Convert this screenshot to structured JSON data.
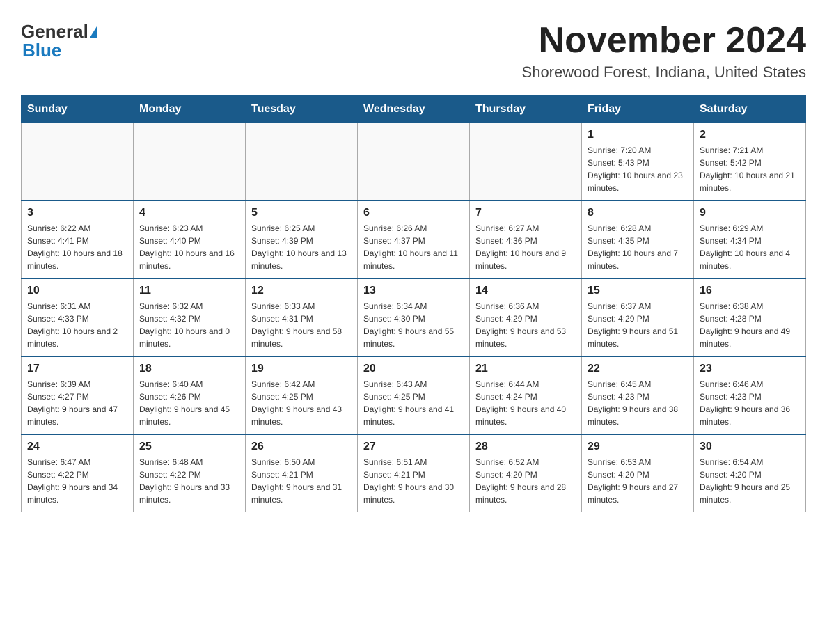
{
  "header": {
    "logo_general": "General",
    "logo_blue": "Blue",
    "month_year": "November 2024",
    "location": "Shorewood Forest, Indiana, United States"
  },
  "days_of_week": [
    "Sunday",
    "Monday",
    "Tuesday",
    "Wednesday",
    "Thursday",
    "Friday",
    "Saturday"
  ],
  "weeks": [
    [
      {
        "day": "",
        "sunrise": "",
        "sunset": "",
        "daylight": ""
      },
      {
        "day": "",
        "sunrise": "",
        "sunset": "",
        "daylight": ""
      },
      {
        "day": "",
        "sunrise": "",
        "sunset": "",
        "daylight": ""
      },
      {
        "day": "",
        "sunrise": "",
        "sunset": "",
        "daylight": ""
      },
      {
        "day": "",
        "sunrise": "",
        "sunset": "",
        "daylight": ""
      },
      {
        "day": "1",
        "sunrise": "Sunrise: 7:20 AM",
        "sunset": "Sunset: 5:43 PM",
        "daylight": "Daylight: 10 hours and 23 minutes."
      },
      {
        "day": "2",
        "sunrise": "Sunrise: 7:21 AM",
        "sunset": "Sunset: 5:42 PM",
        "daylight": "Daylight: 10 hours and 21 minutes."
      }
    ],
    [
      {
        "day": "3",
        "sunrise": "Sunrise: 6:22 AM",
        "sunset": "Sunset: 4:41 PM",
        "daylight": "Daylight: 10 hours and 18 minutes."
      },
      {
        "day": "4",
        "sunrise": "Sunrise: 6:23 AM",
        "sunset": "Sunset: 4:40 PM",
        "daylight": "Daylight: 10 hours and 16 minutes."
      },
      {
        "day": "5",
        "sunrise": "Sunrise: 6:25 AM",
        "sunset": "Sunset: 4:39 PM",
        "daylight": "Daylight: 10 hours and 13 minutes."
      },
      {
        "day": "6",
        "sunrise": "Sunrise: 6:26 AM",
        "sunset": "Sunset: 4:37 PM",
        "daylight": "Daylight: 10 hours and 11 minutes."
      },
      {
        "day": "7",
        "sunrise": "Sunrise: 6:27 AM",
        "sunset": "Sunset: 4:36 PM",
        "daylight": "Daylight: 10 hours and 9 minutes."
      },
      {
        "day": "8",
        "sunrise": "Sunrise: 6:28 AM",
        "sunset": "Sunset: 4:35 PM",
        "daylight": "Daylight: 10 hours and 7 minutes."
      },
      {
        "day": "9",
        "sunrise": "Sunrise: 6:29 AM",
        "sunset": "Sunset: 4:34 PM",
        "daylight": "Daylight: 10 hours and 4 minutes."
      }
    ],
    [
      {
        "day": "10",
        "sunrise": "Sunrise: 6:31 AM",
        "sunset": "Sunset: 4:33 PM",
        "daylight": "Daylight: 10 hours and 2 minutes."
      },
      {
        "day": "11",
        "sunrise": "Sunrise: 6:32 AM",
        "sunset": "Sunset: 4:32 PM",
        "daylight": "Daylight: 10 hours and 0 minutes."
      },
      {
        "day": "12",
        "sunrise": "Sunrise: 6:33 AM",
        "sunset": "Sunset: 4:31 PM",
        "daylight": "Daylight: 9 hours and 58 minutes."
      },
      {
        "day": "13",
        "sunrise": "Sunrise: 6:34 AM",
        "sunset": "Sunset: 4:30 PM",
        "daylight": "Daylight: 9 hours and 55 minutes."
      },
      {
        "day": "14",
        "sunrise": "Sunrise: 6:36 AM",
        "sunset": "Sunset: 4:29 PM",
        "daylight": "Daylight: 9 hours and 53 minutes."
      },
      {
        "day": "15",
        "sunrise": "Sunrise: 6:37 AM",
        "sunset": "Sunset: 4:29 PM",
        "daylight": "Daylight: 9 hours and 51 minutes."
      },
      {
        "day": "16",
        "sunrise": "Sunrise: 6:38 AM",
        "sunset": "Sunset: 4:28 PM",
        "daylight": "Daylight: 9 hours and 49 minutes."
      }
    ],
    [
      {
        "day": "17",
        "sunrise": "Sunrise: 6:39 AM",
        "sunset": "Sunset: 4:27 PM",
        "daylight": "Daylight: 9 hours and 47 minutes."
      },
      {
        "day": "18",
        "sunrise": "Sunrise: 6:40 AM",
        "sunset": "Sunset: 4:26 PM",
        "daylight": "Daylight: 9 hours and 45 minutes."
      },
      {
        "day": "19",
        "sunrise": "Sunrise: 6:42 AM",
        "sunset": "Sunset: 4:25 PM",
        "daylight": "Daylight: 9 hours and 43 minutes."
      },
      {
        "day": "20",
        "sunrise": "Sunrise: 6:43 AM",
        "sunset": "Sunset: 4:25 PM",
        "daylight": "Daylight: 9 hours and 41 minutes."
      },
      {
        "day": "21",
        "sunrise": "Sunrise: 6:44 AM",
        "sunset": "Sunset: 4:24 PM",
        "daylight": "Daylight: 9 hours and 40 minutes."
      },
      {
        "day": "22",
        "sunrise": "Sunrise: 6:45 AM",
        "sunset": "Sunset: 4:23 PM",
        "daylight": "Daylight: 9 hours and 38 minutes."
      },
      {
        "day": "23",
        "sunrise": "Sunrise: 6:46 AM",
        "sunset": "Sunset: 4:23 PM",
        "daylight": "Daylight: 9 hours and 36 minutes."
      }
    ],
    [
      {
        "day": "24",
        "sunrise": "Sunrise: 6:47 AM",
        "sunset": "Sunset: 4:22 PM",
        "daylight": "Daylight: 9 hours and 34 minutes."
      },
      {
        "day": "25",
        "sunrise": "Sunrise: 6:48 AM",
        "sunset": "Sunset: 4:22 PM",
        "daylight": "Daylight: 9 hours and 33 minutes."
      },
      {
        "day": "26",
        "sunrise": "Sunrise: 6:50 AM",
        "sunset": "Sunset: 4:21 PM",
        "daylight": "Daylight: 9 hours and 31 minutes."
      },
      {
        "day": "27",
        "sunrise": "Sunrise: 6:51 AM",
        "sunset": "Sunset: 4:21 PM",
        "daylight": "Daylight: 9 hours and 30 minutes."
      },
      {
        "day": "28",
        "sunrise": "Sunrise: 6:52 AM",
        "sunset": "Sunset: 4:20 PM",
        "daylight": "Daylight: 9 hours and 28 minutes."
      },
      {
        "day": "29",
        "sunrise": "Sunrise: 6:53 AM",
        "sunset": "Sunset: 4:20 PM",
        "daylight": "Daylight: 9 hours and 27 minutes."
      },
      {
        "day": "30",
        "sunrise": "Sunrise: 6:54 AM",
        "sunset": "Sunset: 4:20 PM",
        "daylight": "Daylight: 9 hours and 25 minutes."
      }
    ]
  ]
}
